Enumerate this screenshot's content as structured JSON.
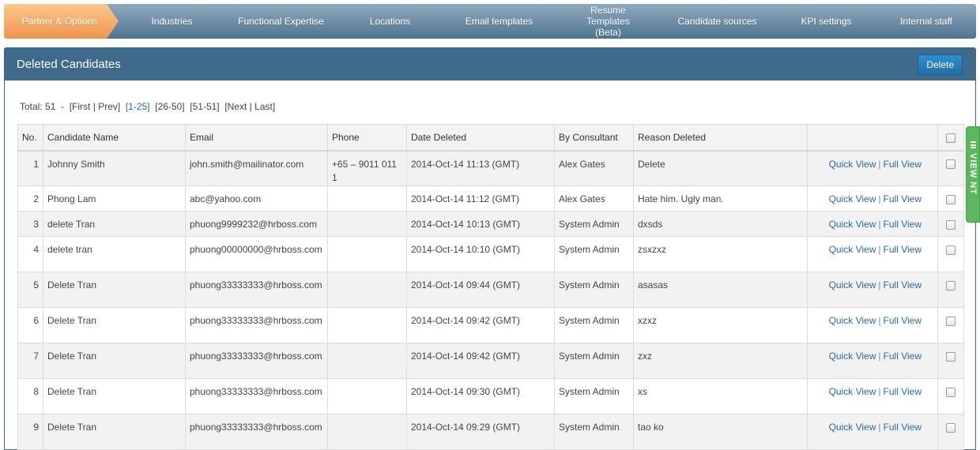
{
  "wizard": {
    "steps": [
      {
        "label": "Partner & Options"
      },
      {
        "label": "Industries"
      },
      {
        "label": "Functional Expertise"
      },
      {
        "label": "Locations"
      },
      {
        "label": "Email templates"
      },
      {
        "label": "Resume Templates (Beta)"
      },
      {
        "label": "Candidate sources"
      },
      {
        "label": "KPI settings"
      },
      {
        "label": "Internal staff"
      }
    ],
    "active_color": "#f0944b",
    "inactive_color": "#4f7592"
  },
  "panel": {
    "title": "Deleted Candidates",
    "delete_label": "Delete",
    "header_color": "#3f6a8c"
  },
  "pager": {
    "total_label": "Total: 51",
    "dash": "-",
    "first": "[First",
    "bar1": "|",
    "prev": "Prev]",
    "range1": "[1-25]",
    "range2": "[26-50]",
    "range3": "[51-51]",
    "next": "[Next",
    "bar2": "|",
    "last": "Last]"
  },
  "table": {
    "headers": {
      "no": "No.",
      "name": "Candidate Name",
      "email": "Email",
      "phone": "Phone",
      "date": "Date Deleted",
      "consultant": "By Consultant",
      "reason": "Reason Deleted"
    },
    "quick_view": "Quick View",
    "separator": "|",
    "full_view": "Full View",
    "rows": [
      {
        "no": "1",
        "name": "Johnny Smith",
        "email": "john.smith@mailinator.com",
        "phone": "+65 – 9011 011 1",
        "date": "2014-Oct-14 11:13 (GMT)",
        "consultant": "Alex Gates",
        "reason": "Delete"
      },
      {
        "no": "2",
        "name": "Phong Lam",
        "email": "abc@yahoo.com",
        "phone": "",
        "date": "2014-Oct-14 11:12 (GMT)",
        "consultant": "Alex Gates",
        "reason": "Hate him. Ugly man."
      },
      {
        "no": "3",
        "name": "delete Tran",
        "email": "phuong9999232@hrboss.com",
        "phone": "",
        "date": "2014-Oct-14 10:13 (GMT)",
        "consultant": "System Admin",
        "reason": "dxsds"
      },
      {
        "no": "4",
        "name": "delete tran",
        "email": "phuong00000000@hrboss.com",
        "phone": "",
        "date": "2014-Oct-14 10:10 (GMT)",
        "consultant": "System Admin",
        "reason": "zsxzxz"
      },
      {
        "no": "5",
        "name": "Delete Tran",
        "email": "phuong33333333@hrboss.com",
        "phone": "",
        "date": "2014-Oct-14 09:44 (GMT)",
        "consultant": "System Admin",
        "reason": "asasas"
      },
      {
        "no": "6",
        "name": "Delete Tran",
        "email": "phuong33333333@hrboss.com",
        "phone": "",
        "date": "2014-Oct-14 09:42 (GMT)",
        "consultant": "System Admin",
        "reason": "xzxz"
      },
      {
        "no": "7",
        "name": "Delete Tran",
        "email": "phuong33333333@hrboss.com",
        "phone": "",
        "date": "2014-Oct-14 09:42 (GMT)",
        "consultant": "System Admin",
        "reason": "zxz"
      },
      {
        "no": "8",
        "name": "Delete Tran",
        "email": "phuong33333333@hrboss.com",
        "phone": "",
        "date": "2014-Oct-14 09:30 (GMT)",
        "consultant": "System Admin",
        "reason": "xs"
      },
      {
        "no": "9",
        "name": "Delete Tran",
        "email": "phuong33333333@hrboss.com",
        "phone": "",
        "date": "2014-Oct-14 09:29 (GMT)",
        "consultant": "System Admin",
        "reason": "tao ko"
      }
    ]
  },
  "side_tab": {
    "label": "VIEW NT",
    "icon": "list-icon",
    "color": "#5cb85c"
  }
}
